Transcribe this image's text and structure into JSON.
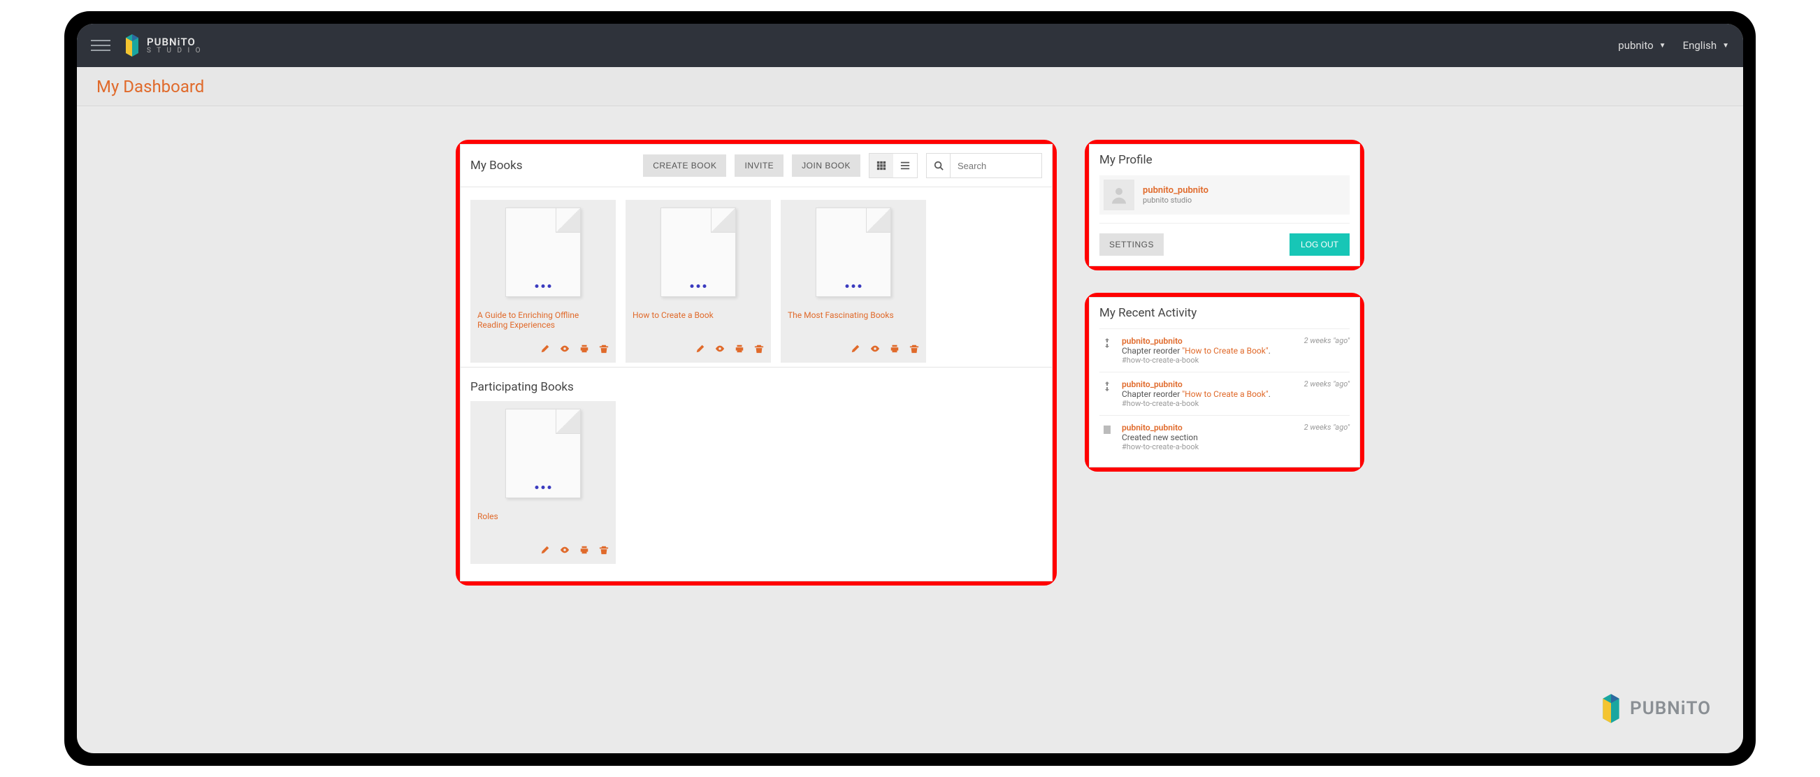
{
  "topbar": {
    "brand": "PUBNiTO",
    "brand_sub": "S T U D I O",
    "user_dd": "pubnito",
    "lang_dd": "English"
  },
  "page": {
    "title": "My Dashboard"
  },
  "mybooks": {
    "title": "My Books",
    "create_label": "CREATE BOOK",
    "invite_label": "INVITE",
    "join_label": "JOIN BOOK",
    "search_placeholder": "Search",
    "books": [
      {
        "title": "A Guide to Enriching Offline Reading Experiences"
      },
      {
        "title": "How to Create a Book"
      },
      {
        "title": "The Most Fascinating Books"
      }
    ]
  },
  "participating": {
    "title": "Participating Books",
    "books": [
      {
        "title": "Roles"
      }
    ]
  },
  "profile": {
    "title": "My Profile",
    "username": "pubnito_pubnito",
    "org": "pubnito studio",
    "settings_label": "SETTINGS",
    "logout_label": "LOG OUT"
  },
  "activity": {
    "title": "My Recent Activity",
    "items": [
      {
        "icon": "reorder",
        "who": "pubnito_pubnito",
        "what_prefix": "Chapter reorder ",
        "what_hl": "\"How to Create a Book\"",
        "what_suffix": ".",
        "tag": "#how-to-create-a-book",
        "time": "2 weeks \"ago\""
      },
      {
        "icon": "reorder",
        "who": "pubnito_pubnito",
        "what_prefix": "Chapter reorder ",
        "what_hl": "\"How to Create a Book\"",
        "what_suffix": ".",
        "tag": "#how-to-create-a-book",
        "time": "2 weeks \"ago\""
      },
      {
        "icon": "section",
        "who": "pubnito_pubnito",
        "what_prefix": "Created new section",
        "what_hl": "",
        "what_suffix": "",
        "tag": "#how-to-create-a-book",
        "time": "2 weeks \"ago\""
      }
    ]
  },
  "watermark": {
    "brand": "PUBNiTO"
  }
}
